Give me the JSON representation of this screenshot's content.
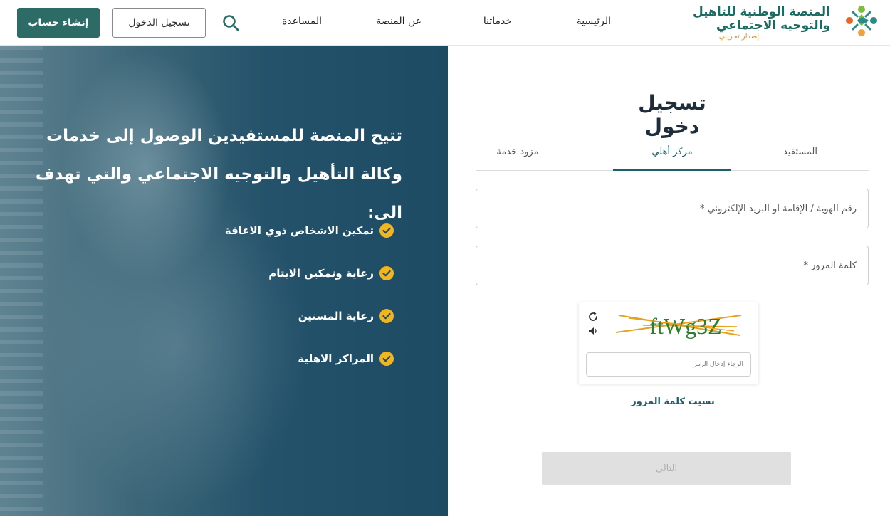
{
  "header": {
    "logo": {
      "line1": "المنصة الوطنية للتاهيل",
      "line2": "والتوجيه الاجتماعي",
      "badge": "إصدار تجريبي"
    },
    "nav": {
      "home": "الرئيسية",
      "services": "خدماتنا",
      "about": "عن المنصة",
      "help": "المساعدة"
    },
    "login_label": "تسجيل الدخول",
    "register_label": "إنشاء حساب"
  },
  "hero": {
    "title": "تتيح المنصة للمستفيدين الوصول إلى خدمات وكالة التأهيل والتوجيه الاجتماعي والتي تهدف الى:",
    "features": [
      "تمكين الاشخاص ذوي الاعاقة",
      "رعاية وتمكين الايتام",
      "رعاية المسنين",
      "المراكز الاهلية"
    ]
  },
  "login": {
    "title": "تسجيل دخول",
    "tabs": [
      "المستفيد",
      "مركز أهلي",
      "مزود خدمة"
    ],
    "active_tab": "مركز أهلي",
    "id_placeholder": "رقم الهوية / الإقامة أو البريد الإلكتروني *",
    "password_placeholder": "كلمة المرور *",
    "captcha": {
      "code": "ftWg3Z",
      "input_placeholder": "الرجاء إدخال الرمز"
    },
    "forgot_password": "نسيت كلمة المرور",
    "next_label": "التالي"
  },
  "colors": {
    "brand_teal": "#2c6b66",
    "tab_active": "#1f5f6c",
    "hero_bg": "#1d4b63",
    "check_yellow": "#f2b51d"
  },
  "icons": {
    "search": "search-icon",
    "check": "check-circle-icon",
    "refresh": "refresh-icon",
    "audio": "speaker-icon"
  }
}
